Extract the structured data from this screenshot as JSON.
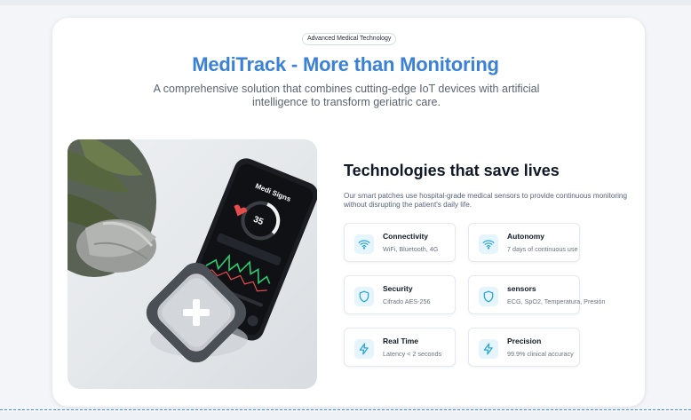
{
  "hero": {
    "badge": "Advanced Medical Technology",
    "title": "MediTrack - More than Monitoring",
    "subtitle": "A comprehensive solution that combines cutting-edge IoT devices with artificial intelligence to transform geriatric care."
  },
  "technologies": {
    "title": "Technologies that save lives",
    "description": "Our smart patches use hospital-grade medical sensors to provide continuous monitoring without disrupting the patient's daily life."
  },
  "features": [
    {
      "title": "Connectivity",
      "subtitle": "WiFi, Bluetooth, 4G",
      "icon": "wifi-icon"
    },
    {
      "title": "Autonomy",
      "subtitle": "7 days of continuous use",
      "icon": "wifi-icon"
    },
    {
      "title": "Security",
      "subtitle": "Cifrado AES-256",
      "icon": "shield-icon"
    },
    {
      "title": "sensors",
      "subtitle": "ECG, SpO2, Temperatura, Presión",
      "icon": "shield-icon"
    },
    {
      "title": "Real Time",
      "subtitle": "Latency < 2 seconds",
      "icon": "lightning-icon"
    },
    {
      "title": "Precision",
      "subtitle": "99.9% clinical accuracy",
      "icon": "lightning-icon"
    }
  ],
  "phone": {
    "app_title": "Medi Signs",
    "reading": "35"
  },
  "colors": {
    "accent": "#3b82d6",
    "icon_tint": "#2aa6d8",
    "icon_bg": "#e6f4fb"
  }
}
